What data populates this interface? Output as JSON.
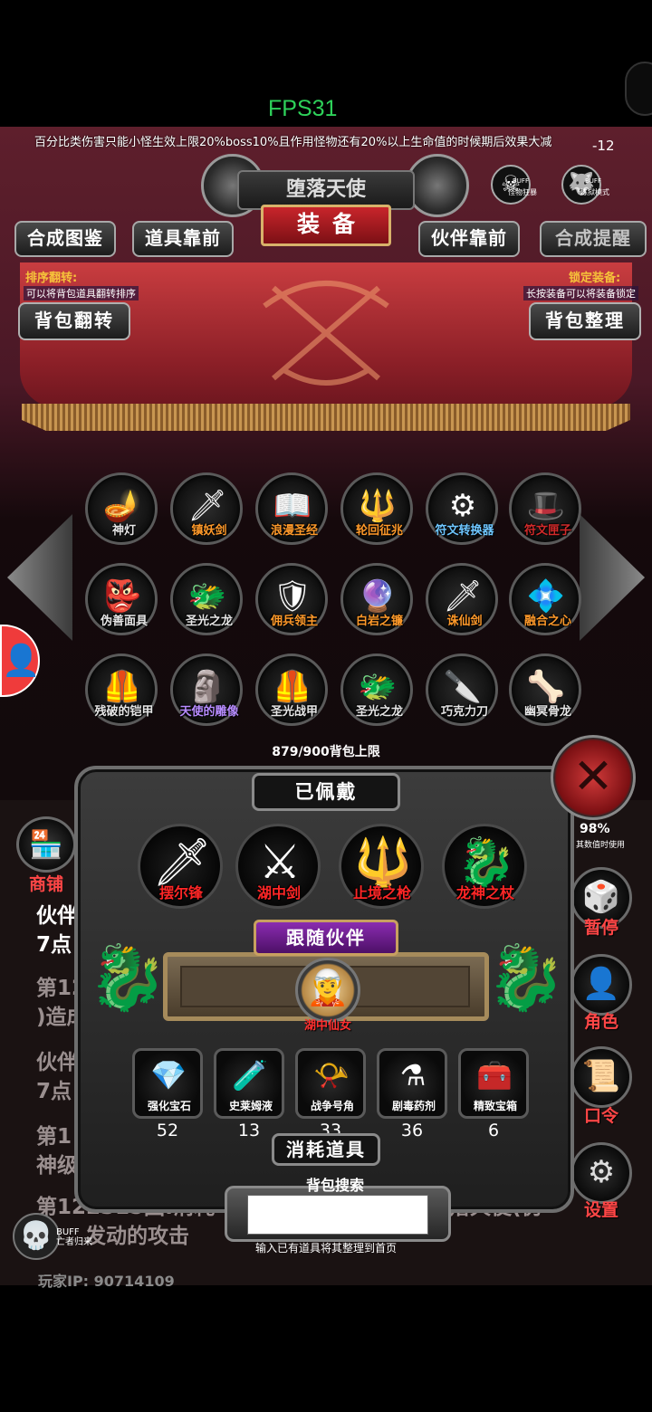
{
  "status": {
    "fps": "FPS31"
  },
  "notice": {
    "text": "百分比类伤害只能小怪生效上限20%boss10%且作用怪物还有20%以上生命值的时候期后效果大减",
    "corner": "-12"
  },
  "header": {
    "boss_name": "堕落天使",
    "panel_title": "装备"
  },
  "buffs": [
    {
      "icon": "ghost-skull-icon",
      "tag": "BUFF",
      "label": "怪物狂暴"
    },
    {
      "icon": "wolf-icon",
      "tag": "BUFF",
      "label": "炼狱模式"
    }
  ],
  "tabs": [
    "合成图鉴",
    "道具靠前",
    "伙伴靠前",
    "合成提醒"
  ],
  "left_info": {
    "title": "排序翻转:",
    "desc": "可以将背包道具翻转排序",
    "button": "背包翻转"
  },
  "right_info": {
    "title": "锁定装备:",
    "desc": "长按装备可以将装备锁定",
    "button": "背包整理"
  },
  "inventory": [
    {
      "name": "神灯",
      "icon": "magic-lamp-icon",
      "color": "white"
    },
    {
      "name": "镇妖剑",
      "icon": "sword-icon",
      "color": "orange"
    },
    {
      "name": "浪漫圣经",
      "icon": "book-icon",
      "color": "orange"
    },
    {
      "name": "轮回征兆",
      "icon": "crystal-staff-icon",
      "color": "orange"
    },
    {
      "name": "符文转换器",
      "icon": "rune-converter-icon",
      "color": "blue"
    },
    {
      "name": "符文匣子",
      "icon": "rune-box-icon",
      "color": "red"
    },
    {
      "name": "伪善面具",
      "icon": "mask-icon",
      "color": "white"
    },
    {
      "name": "圣光之龙",
      "icon": "dragon-icon",
      "color": "white"
    },
    {
      "name": "佣兵领主",
      "icon": "knight-icon",
      "color": "orange"
    },
    {
      "name": "白岩之镰",
      "icon": "scythe-icon",
      "color": "orange"
    },
    {
      "name": "诛仙剑",
      "icon": "sword-icon",
      "color": "orange"
    },
    {
      "name": "融合之心",
      "icon": "heart-icon",
      "color": "orange"
    },
    {
      "name": "残破的铠甲",
      "icon": "armor-icon",
      "color": "white"
    },
    {
      "name": "天使的雕像",
      "icon": "angel-statue-icon",
      "color": "purple"
    },
    {
      "name": "圣光战甲",
      "icon": "armor-icon",
      "color": "white"
    },
    {
      "name": "圣光之龙",
      "icon": "dragon-icon",
      "color": "white"
    },
    {
      "name": "巧克力刀",
      "icon": "blade-icon",
      "color": "white"
    },
    {
      "name": "幽冥骨龙",
      "icon": "bone-dragon-icon",
      "color": "white"
    }
  ],
  "capacity": "879/900背包上限",
  "worn": {
    "title": "已佩戴",
    "items": [
      {
        "name": "摆尔锋",
        "icon": "purple-sword-icon"
      },
      {
        "name": "湖中剑",
        "icon": "golden-sword-icon"
      },
      {
        "name": "止境之枪",
        "icon": "spear-icon"
      },
      {
        "name": "龙神之杖",
        "icon": "dragon-staff-icon"
      }
    ]
  },
  "partner": {
    "title": "跟随伙伴",
    "name": "湖中仙女",
    "icon": "fairy-avatar-icon"
  },
  "consumables": {
    "title": "消耗道具",
    "items": [
      {
        "name": "强化宝石",
        "count": "52",
        "icon": "gem-icon"
      },
      {
        "name": "史莱姆液",
        "count": "13",
        "icon": "potion-icon"
      },
      {
        "name": "战争号角",
        "count": "33",
        "icon": "horn-icon"
      },
      {
        "name": "剧毒药剂",
        "count": "36",
        "icon": "poison-icon"
      },
      {
        "name": "精致宝箱",
        "count": "6",
        "icon": "chest-icon"
      }
    ]
  },
  "search": {
    "label": "背包搜索",
    "hint": "输入已有道具将其整理到首页",
    "value": ""
  },
  "log": {
    "lines": [
      "伙伴",
      "7点",
      "第122",
      ")造成",
      "伙伴",
      "7点",
      "第1",
      "神级",
      "第122315回:消耗",
      "落天使(伪",
      "发动的攻击"
    ],
    "partial": "98%",
    "partial2": "其数值时使用"
  },
  "side": {
    "shop": "商铺",
    "pause": "暂停",
    "role": "角色",
    "code": "口令",
    "settings": "设置"
  },
  "footer": {
    "ip": "玩家IP:  90714109",
    "buff_tag": "BUFF",
    "buff_name": "亡者归来"
  }
}
